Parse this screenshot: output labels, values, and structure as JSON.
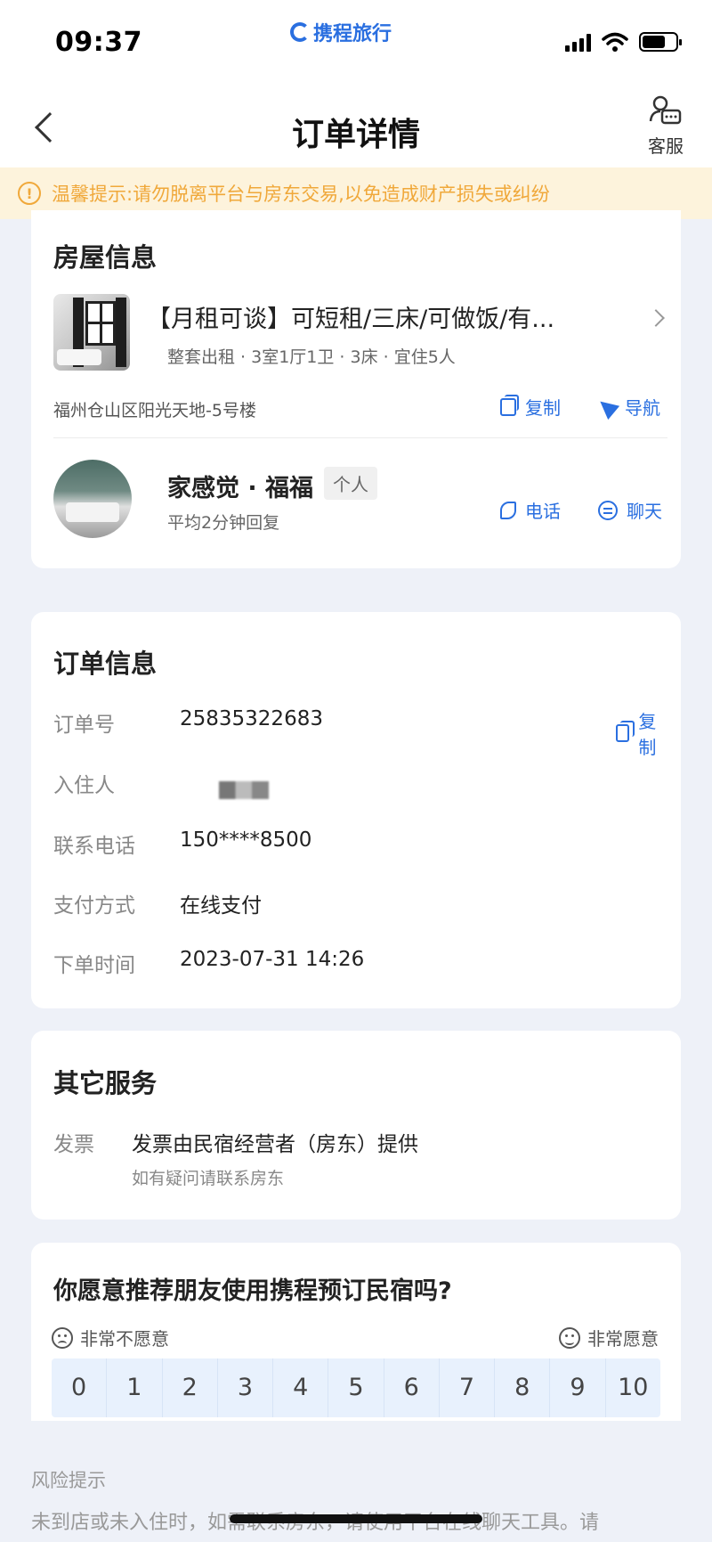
{
  "status_bar": {
    "time": "09:37",
    "brand": "携程旅行",
    "battery_level": 0.7
  },
  "nav": {
    "title": "订单详情",
    "service_label": "客服"
  },
  "notice": {
    "text": "温馨提示:请勿脱离平台与房东交易,以免造成财产损失或纠纷"
  },
  "house": {
    "section_title": "房屋信息",
    "listing_title": "【月租可谈】可短租/三床/可做饭/有...",
    "listing_meta": "整套出租 · 3室1厅1卫 · 3床 · 宜住5人",
    "address": "福州仓山区阳光天地-5号楼",
    "copy_label": "复制",
    "navigate_label": "导航",
    "host_name": "家感觉 · 福福",
    "host_tag": "个人",
    "host_reply": "平均2分钟回复",
    "phone_label": "电话",
    "chat_label": "聊天"
  },
  "order": {
    "section_title": "订单信息",
    "copy_label": "复制",
    "fields": [
      {
        "label": "订单号",
        "value": "25835322683"
      },
      {
        "label": "入住人",
        "value": ""
      },
      {
        "label": "联系电话",
        "value": "150****8500"
      },
      {
        "label": "支付方式",
        "value": "在线支付"
      },
      {
        "label": "下单时间",
        "value": "2023-07-31 14:26"
      }
    ]
  },
  "other_services": {
    "section_title": "其它服务",
    "invoice_label": "发票",
    "invoice_value": "发票由民宿经营者（房东）提供",
    "invoice_note": "如有疑问请联系房东"
  },
  "nps": {
    "question": "你愿意推荐朋友使用携程预订民宿吗?",
    "low_label": "非常不愿意",
    "high_label": "非常愿意",
    "scale": [
      "0",
      "1",
      "2",
      "3",
      "4",
      "5",
      "6",
      "7",
      "8",
      "9",
      "10"
    ]
  },
  "risk": {
    "title": "风险提示",
    "text": "未到店或未入住时，如需联系房东，请使用平台在线聊天工具。请"
  },
  "colors": {
    "accent": "#2a6fe0",
    "warning": "#f0a83a",
    "background": "#eef1f8"
  }
}
